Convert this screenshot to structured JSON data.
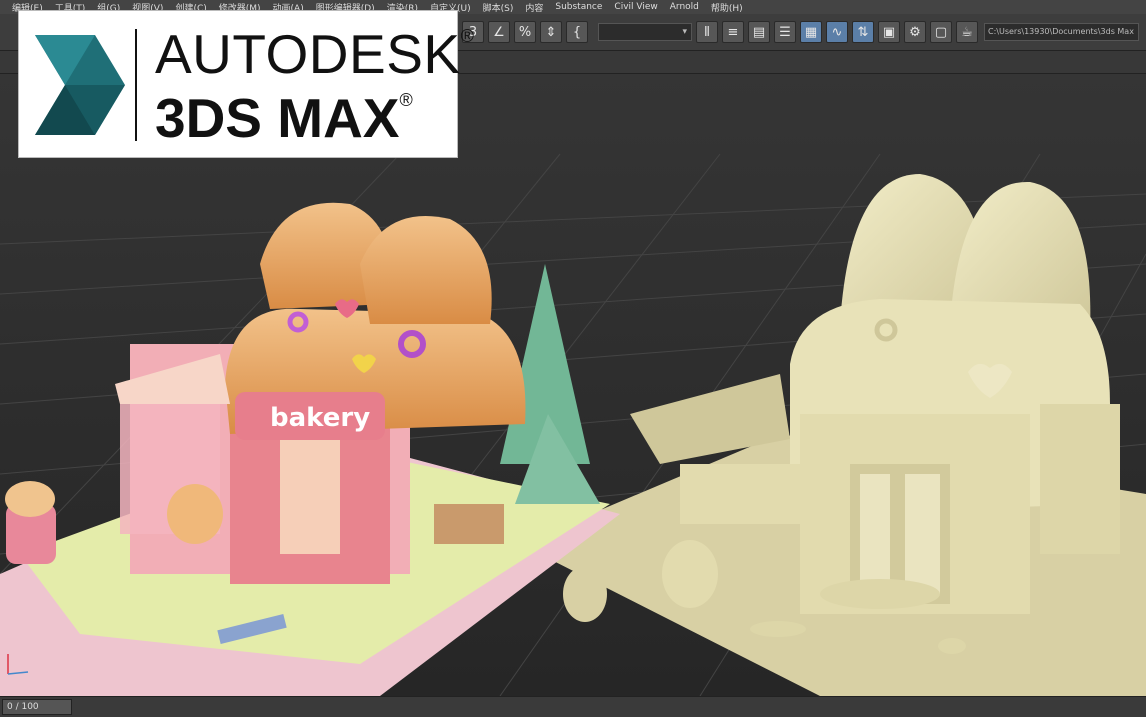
{
  "menu": [
    "编辑(E)",
    "工具(T)",
    "组(G)",
    "视图(V)",
    "创建(C)",
    "修改器(M)",
    "动画(A)",
    "图形编辑器(D)",
    "渲染(R)",
    "自定义(U)",
    "脚本(S)",
    "内容",
    "Substance",
    "Civil View",
    "Arnold",
    "帮助(H)"
  ],
  "toolbar": {
    "path": "C:\\Users\\13930\\Documents\\3ds Max",
    "icons": [
      "3-snap-icon",
      "angle-snap-icon",
      "percent-snap-icon",
      "spinner-snap-icon",
      "named-selection-icon",
      "mirror-icon",
      "align-icon",
      "layer-explorer-icon",
      "scene-explorer-icon",
      "ribbon-icon",
      "curve-editor-icon",
      "schematic-icon",
      "material-editor-icon",
      "render-setup-icon",
      "render-frame-icon",
      "render-icon"
    ]
  },
  "logo": {
    "line1": "AUTODESK",
    "line2": "3DS MAX",
    "reg": "®"
  },
  "viewport": {
    "sign_text": "bakery"
  },
  "timeline": {
    "frame": "0 / 100"
  },
  "colors": {
    "ui_bg": "#3d3d3d",
    "viewport_bg": "#2f2f2f",
    "logo_teal": "#1f6f77",
    "clay": "#e8e2b8"
  }
}
